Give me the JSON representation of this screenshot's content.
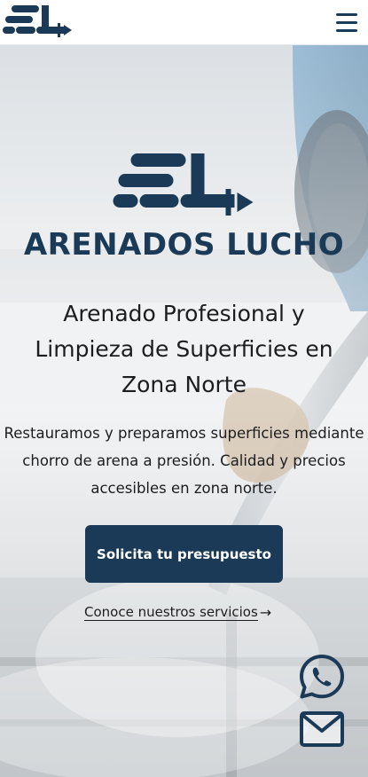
{
  "header": {
    "logo_icon": "arenados-lucho-logo-mark",
    "menu_icon": "hamburger-menu-icon"
  },
  "hero": {
    "logo_icon": "arenados-lucho-logo-mark",
    "brand_name": "ARENADOS LUCHO",
    "headline": "Arenado Profesional y Limpieza de Superficies en Zona Norte",
    "subtext": "Restauramos y preparamos superficies mediante chorro de arena a presión. Calidad y precios accesibles en zona norte.",
    "cta_label": "Solicita tu presupuesto",
    "services_link_label": "Conoce nuestros servicios",
    "services_link_arrow": "→"
  },
  "floating": {
    "whatsapp_icon": "whatsapp-icon",
    "mail_icon": "mail-icon"
  },
  "colors": {
    "brand": "#1b3a57",
    "text": "#1d1d1f",
    "background": "#ffffff"
  }
}
